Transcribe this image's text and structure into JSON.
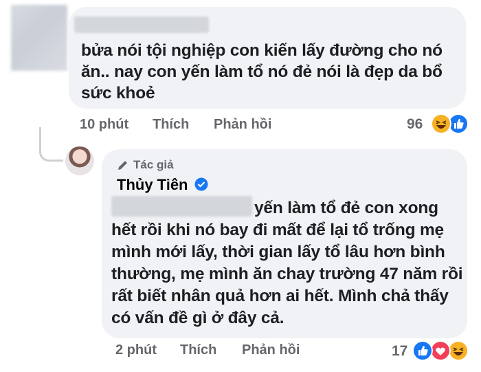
{
  "comment1": {
    "text": "bửa nói tội nghiệp con kiến lấy đường cho nó ăn.. nay con yến làm tổ nó đẻ nói là đẹp da bổ sức khoẻ",
    "time": "10 phút",
    "like_label": "Thích",
    "reply_label": "Phản hồi",
    "reaction_count": "96",
    "reactions": [
      "haha-icon",
      "like-icon"
    ]
  },
  "reply": {
    "author_tag": "Tác giả",
    "author_name": "Thủy Tiên",
    "text": "yến làm tổ đẻ con xong hết rồi khi nó bay đi mất để lại tổ trống mẹ mình mới lấy, thời gian lấy tổ lâu hơn bình thường, mẹ mình ăn chay trường 47 năm rồi rất biết nhân quả hơn ai hết. Mình chả thấy có vấn đề gì ở đây cả.",
    "time": "2 phút",
    "like_label": "Thích",
    "reply_label": "Phản hồi",
    "reaction_count": "17",
    "reactions": [
      "like-icon",
      "love-icon",
      "haha-icon"
    ]
  },
  "colors": {
    "bubble": "#f0f2f5",
    "meta": "#65676b",
    "like": "#1877f2",
    "love": "#f33e58",
    "haha": "#f7b125"
  }
}
